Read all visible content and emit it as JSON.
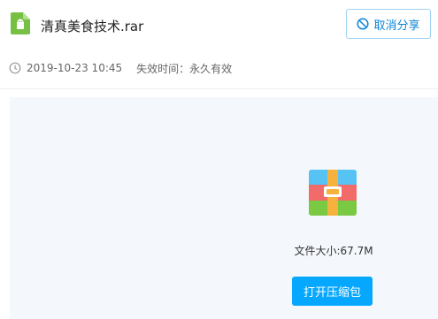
{
  "file": {
    "name": "清真美食技术.rar",
    "icon": "android-file-icon",
    "icon_color": "#76c043"
  },
  "header": {
    "cancel_share_label": "取消分享",
    "cancel_share_icon": "cancel-icon",
    "accent_color": "#0a86d8"
  },
  "meta": {
    "clock_icon": "clock-icon",
    "date": "2019-10-23 10:45",
    "expiry": "失效时间：永久有效"
  },
  "preview": {
    "archive_icon": "archive-icon",
    "file_size": "文件大小:67.7M",
    "open_label": "打开压缩包",
    "button_color": "#06a7ff"
  }
}
